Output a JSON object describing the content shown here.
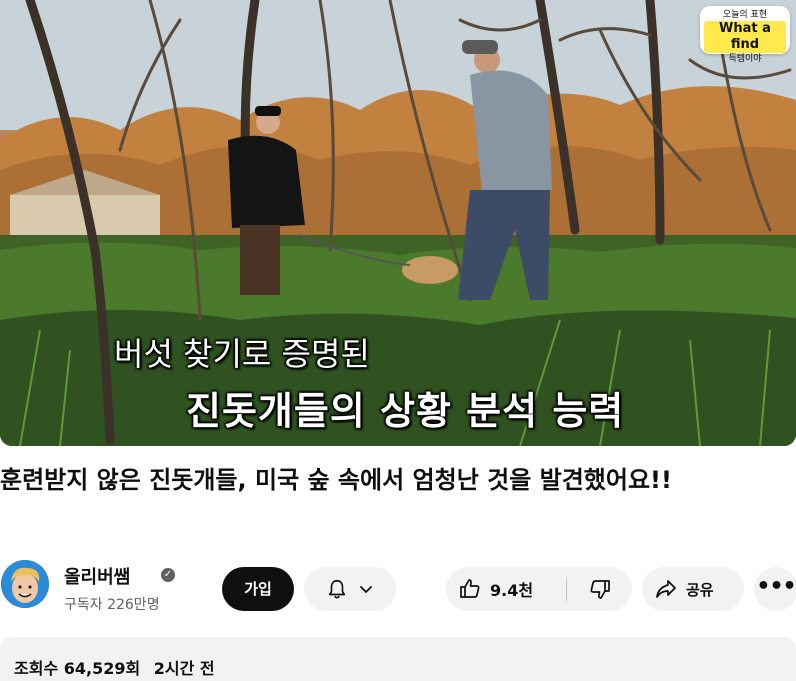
{
  "video": {
    "badge": {
      "line1": "오늘의 표현",
      "line2": "What a find",
      "line3": "득템이야"
    },
    "caption_line1": "버섯 찾기로 증명된",
    "caption_line2": "진돗개들의 상황 분석 능력"
  },
  "title": "훈련받지 않은 진돗개들, 미국 숲 속에서 엄청난 것을 발견했어요!!",
  "channel": {
    "name": "올리버쌤",
    "verified_icon": "verified-check-icon",
    "subscribers": "구독자 226만명"
  },
  "actions": {
    "join_label": "가입",
    "bell_icon": "bell-icon",
    "chevron_icon": "chevron-down-icon",
    "like_count": "9.4천",
    "like_icon": "thumbs-up-icon",
    "dislike_icon": "thumbs-down-icon",
    "share_label": "공유",
    "share_icon": "share-arrow-icon",
    "more_label": "•••"
  },
  "description": {
    "views": "조회수 64,529회",
    "time": "2시간 전"
  },
  "colors": {
    "primary_text": "#0f0f0f",
    "secondary_text": "#606060",
    "button_bg": "#f2f2f2",
    "join_bg": "#0f0f0f",
    "badge_highlight": "#ffe94d"
  }
}
